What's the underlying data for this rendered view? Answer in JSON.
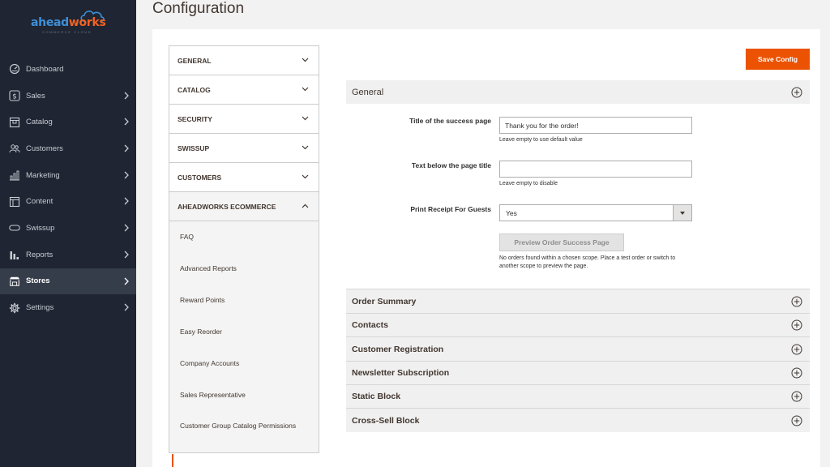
{
  "brand": {
    "logo_main": "ahead",
    "logo_accent": "works",
    "logo_sub": "COMMERCE CLOUD",
    "accent_color": "#eb5202"
  },
  "sidebar": {
    "items": [
      {
        "label": "Dashboard",
        "icon": "dashboard-icon"
      },
      {
        "label": "Sales",
        "icon": "dollar-icon"
      },
      {
        "label": "Catalog",
        "icon": "box-icon"
      },
      {
        "label": "Customers",
        "icon": "users-icon"
      },
      {
        "label": "Marketing",
        "icon": "bar-chart-icon"
      },
      {
        "label": "Content",
        "icon": "layout-icon"
      },
      {
        "label": "Swissup",
        "icon": "pill-icon"
      },
      {
        "label": "Reports",
        "icon": "reports-icon"
      },
      {
        "label": "Stores",
        "icon": "store-icon"
      },
      {
        "label": "Settings",
        "icon": "gear-icon"
      }
    ],
    "active": "Stores"
  },
  "page": {
    "title": "Configuration",
    "save_label": "Save Config"
  },
  "tabs": {
    "items": [
      "GENERAL",
      "CATALOG",
      "SECURITY",
      "SWISSUP",
      "CUSTOMERS",
      "AHEADWORKS ECOMMERCE"
    ],
    "sub_items": [
      "FAQ",
      "Advanced Reports",
      "Reward Points",
      "Easy Reorder",
      "Company Accounts",
      "Sales Representative",
      "Customer Group Catalog Permissions"
    ]
  },
  "general_section": {
    "title": "General",
    "success_title_label": "Title of the success page",
    "success_title_value": "Thank you for the order!",
    "success_title_note": "Leave empty to use default value",
    "below_title_label": "Text below the page title",
    "below_title_value": "",
    "below_title_note": "Leave empty to disable",
    "print_receipt_label": "Print Receipt For Guests",
    "print_receipt_value": "Yes",
    "preview_label": "Preview Order Success Page",
    "preview_note": "No orders found within a chosen scope. Place a test order or switch to another scope to preview the page."
  },
  "sections": [
    "Order Summary",
    "Contacts",
    "Customer Registration",
    "Newsletter Subscription",
    "Static Block",
    "Cross-Sell Block"
  ]
}
